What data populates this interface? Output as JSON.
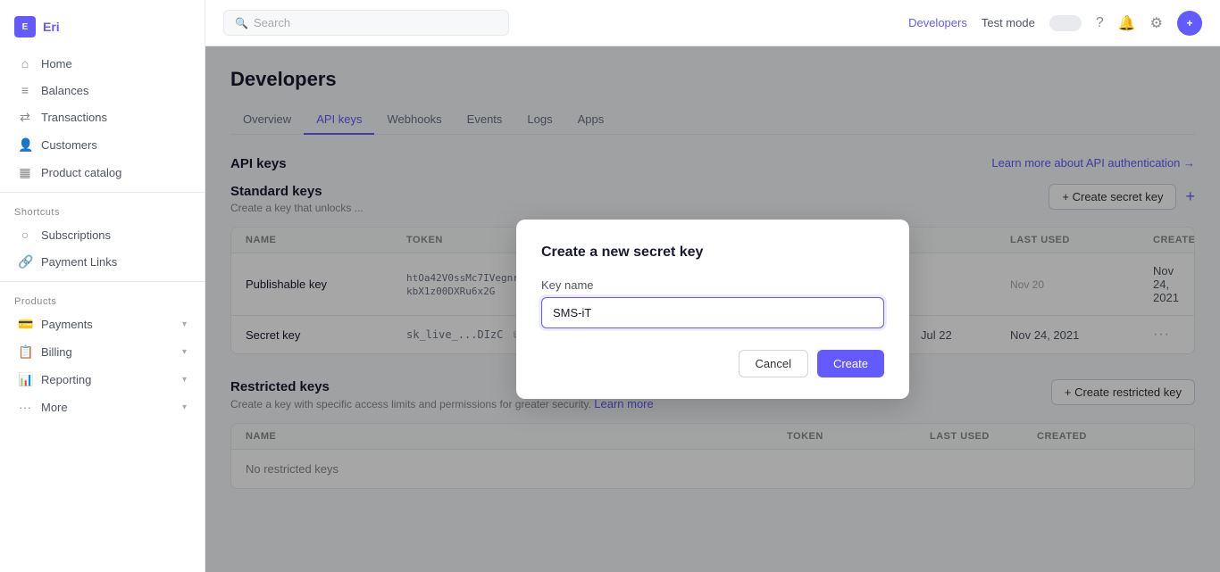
{
  "sidebar": {
    "logo_text": "Eri",
    "nav_items": [
      {
        "id": "home",
        "label": "Home",
        "icon": "⌂"
      },
      {
        "id": "balances",
        "label": "Balances",
        "icon": "⊟"
      },
      {
        "id": "transactions",
        "label": "Transactions",
        "icon": "↔"
      },
      {
        "id": "customers",
        "label": "Customers",
        "icon": "👤"
      },
      {
        "id": "product-catalog",
        "label": "Product catalog",
        "icon": "▦"
      }
    ],
    "shortcuts_label": "Shortcuts",
    "shortcuts": [
      {
        "id": "subscriptions",
        "label": "Subscriptions",
        "icon": "○"
      },
      {
        "id": "payment-links",
        "label": "Payment Links",
        "icon": "🔗"
      }
    ],
    "products_label": "Products",
    "products": [
      {
        "id": "payments",
        "label": "Payments",
        "icon": "💳",
        "has_arrow": true
      },
      {
        "id": "billing",
        "label": "Billing",
        "icon": "📋",
        "has_arrow": true
      },
      {
        "id": "reporting",
        "label": "Reporting",
        "icon": "📊",
        "has_arrow": true
      },
      {
        "id": "more",
        "label": "More",
        "icon": "···",
        "has_arrow": true
      }
    ]
  },
  "topbar": {
    "search_placeholder": "Search",
    "developers_label": "Developers",
    "test_mode_label": "Test mode",
    "help_icon": "?",
    "notifications_icon": "🔔",
    "settings_icon": "⚙",
    "add_icon": "+"
  },
  "page": {
    "title": "Developers",
    "tabs": [
      {
        "id": "overview",
        "label": "Overview",
        "active": false
      },
      {
        "id": "api-keys",
        "label": "API keys",
        "active": true
      },
      {
        "id": "webhooks",
        "label": "Webhooks",
        "active": false
      },
      {
        "id": "events",
        "label": "Events",
        "active": false
      },
      {
        "id": "logs",
        "label": "Logs",
        "active": false
      },
      {
        "id": "apps",
        "label": "Apps",
        "active": false
      }
    ]
  },
  "api_keys_section": {
    "title": "API keys",
    "learn_more_text": "Learn more about API authentication →",
    "standard_keys": {
      "title": "Standard keys",
      "description": "Create a key that unlocks ...",
      "create_button": "+ Create secret key",
      "table_headers": [
        "NAME",
        "TOKEN",
        "",
        "LAST USED",
        "CREATED",
        ""
      ],
      "rows": [
        {
          "name": "Publishable key",
          "token_lines": [
            "htOa42V0ssMc7IVegnriZoN5ssnFzgIkD3qh2nRwVdNI1h",
            "kbX1z00DXRu6x2G"
          ],
          "last_used": "",
          "created": "Nov 24, 2021",
          "has_info": false
        },
        {
          "name": "Secret key",
          "token": "sk_live_...DIzC",
          "last_used": "Jul 22",
          "created": "Nov 24, 2021",
          "has_info": true
        }
      ]
    },
    "restricted_keys": {
      "title": "Restricted keys",
      "description": "Create a key with specific access limits and permissions for greater security.",
      "learn_more_text": "Learn more",
      "create_button": "+ Create restricted key",
      "table_headers": [
        "NAME",
        "TOKEN",
        "LAST USED",
        "CREATED"
      ],
      "no_keys_text": "No restricted keys"
    }
  },
  "modal": {
    "title": "Create a new secret key",
    "key_name_label": "Key name",
    "key_name_value": "SMS-iT",
    "cancel_label": "Cancel",
    "create_label": "Create"
  }
}
